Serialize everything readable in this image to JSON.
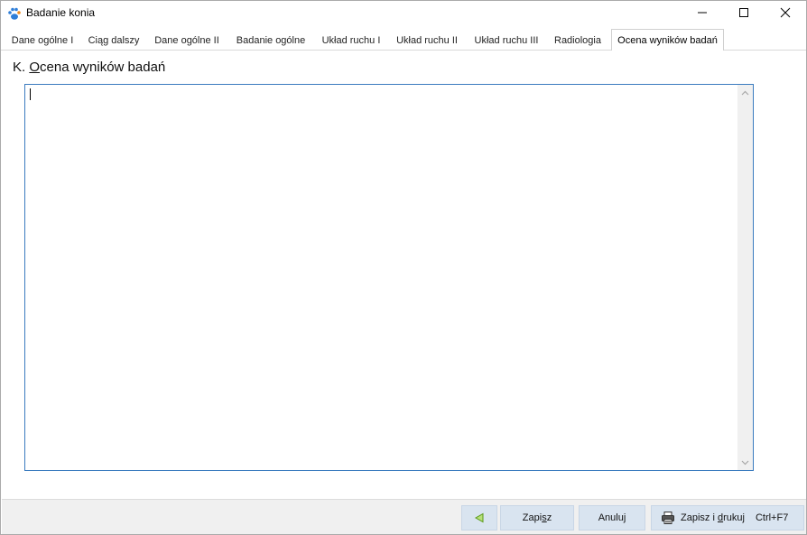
{
  "window": {
    "title": "Badanie konia"
  },
  "tabs": [
    {
      "label": "Dane ogólne I"
    },
    {
      "label": "Ciąg dalszy"
    },
    {
      "label": "Dane ogólne II"
    },
    {
      "label": "Badanie ogólne"
    },
    {
      "label": "Układ ruchu I"
    },
    {
      "label": "Układ ruchu II"
    },
    {
      "label": "Układ ruchu III"
    },
    {
      "label": "Radiologia"
    },
    {
      "label": "Ocena wyników badań",
      "active": true
    }
  ],
  "section": {
    "prefix": "K. ",
    "underlined_char": "O",
    "rest": "cena wyników badań"
  },
  "textarea": {
    "value": ""
  },
  "buttons": {
    "save_pre": "Zapi",
    "save_u": "s",
    "save_post": "z",
    "cancel": "Anuluj",
    "saveprint_pre": "Zapisz i ",
    "saveprint_u": "d",
    "saveprint_post": "rukuj",
    "saveprint_shortcut": "Ctrl+F7"
  },
  "colors": {
    "accent_border": "#3a7bbf",
    "button_bg": "#d9e4f0",
    "back_arrow": "#7bbf2a"
  },
  "icons": {
    "app": "paw-icon",
    "back": "triangle-left-icon",
    "print": "printer-icon"
  }
}
